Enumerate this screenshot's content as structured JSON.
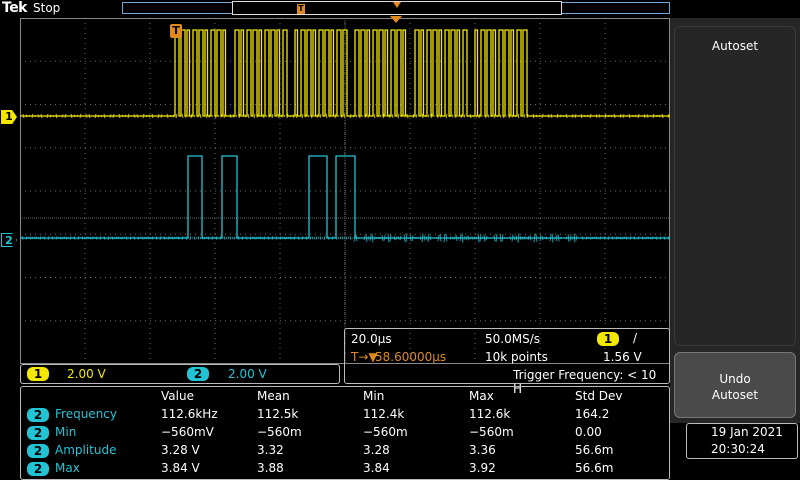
{
  "brand": "Tek",
  "status": "Stop",
  "colors": {
    "ch1": "#f4e800",
    "ch2": "#22c4d4",
    "trigger": "#e08a1e",
    "grid": "#6a6a6a"
  },
  "record_marker": "T",
  "channel_markers": {
    "ch1": "1",
    "ch2": "2",
    "trigger": "T"
  },
  "menu": {
    "autoset": "Autoset",
    "undo_autoset_line1": "Undo",
    "undo_autoset_line2": "Autoset"
  },
  "vertical": [
    {
      "channel": "1",
      "scale": "2.00 V"
    },
    {
      "channel": "2",
      "scale": "2.00 V"
    }
  ],
  "horizontal": {
    "timebase": "20.0µs",
    "sample_rate": "50.0MS/s",
    "trigger_channel": "1",
    "trigger_slope": "/",
    "delay_prefix": "T→▼",
    "delay": "58.60000µs",
    "record_length": "10k points",
    "trigger_level": "1.56 V",
    "trigger_frequency": "Trigger Frequency: < 10 H"
  },
  "measurements": {
    "headers": [
      "Value",
      "Mean",
      "Min",
      "Max",
      "Std Dev"
    ],
    "rows": [
      {
        "ch": "2",
        "name": "Frequency",
        "value": "112.6kHz",
        "mean": "112.5k",
        "min": "112.4k",
        "max": "112.6k",
        "std": "164.2"
      },
      {
        "ch": "2",
        "name": "Min",
        "value": "−560mV",
        "mean": "−560m",
        "min": "−560m",
        "max": "−560m",
        "std": "0.00"
      },
      {
        "ch": "2",
        "name": "Amplitude",
        "value": "3.28 V",
        "mean": "3.32",
        "min": "3.28",
        "max": "3.36",
        "std": "56.6m"
      },
      {
        "ch": "2",
        "name": "Max",
        "value": "3.84 V",
        "mean": "3.88",
        "min": "3.84",
        "max": "3.92",
        "std": "56.6m"
      }
    ]
  },
  "date": "19 Jan  2021",
  "time": "20:30:24"
}
